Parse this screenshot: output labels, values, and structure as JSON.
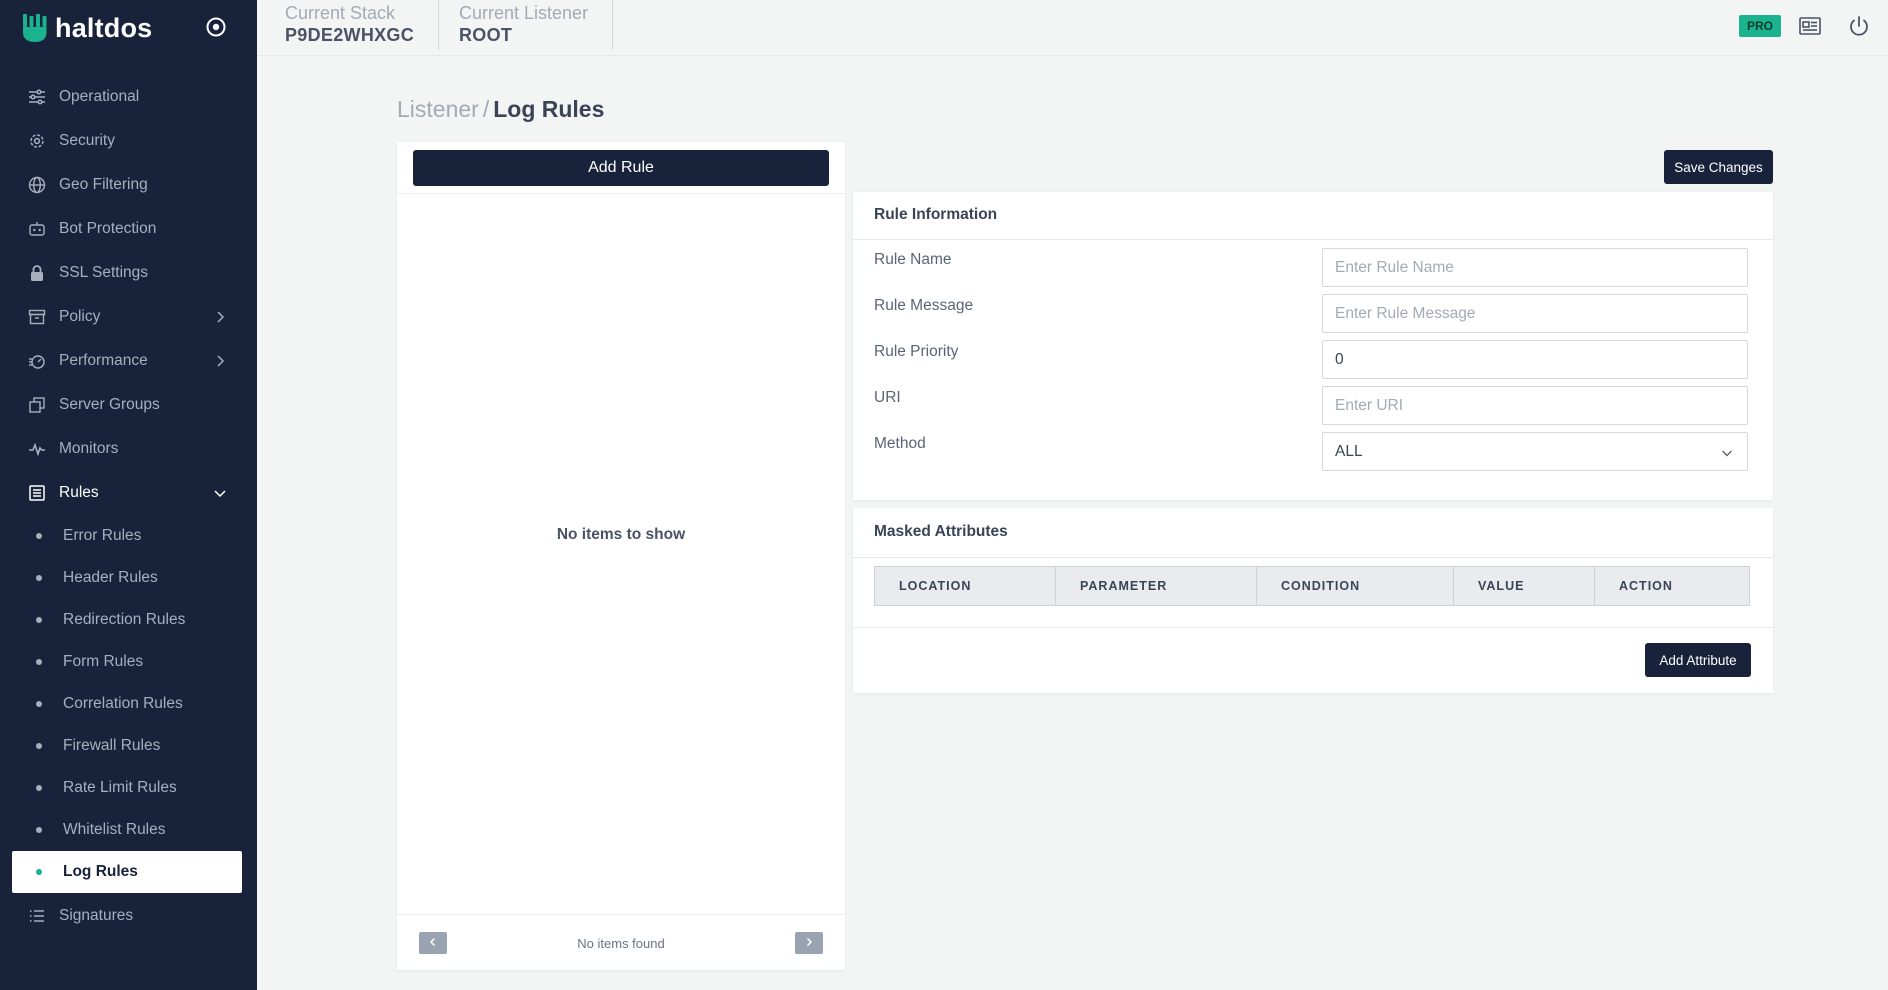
{
  "brand": {
    "name": "haltdos"
  },
  "sidebar": {
    "items": [
      {
        "label": "Operational",
        "icon": "sliders-icon"
      },
      {
        "label": "Security",
        "icon": "gear-icon"
      },
      {
        "label": "Geo Filtering",
        "icon": "globe-icon"
      },
      {
        "label": "Bot Protection",
        "icon": "robot-icon"
      },
      {
        "label": "SSL Settings",
        "icon": "lock-icon"
      },
      {
        "label": "Policy",
        "icon": "archive-icon",
        "has_children": true
      },
      {
        "label": "Performance",
        "icon": "speedometer-icon",
        "has_children": true
      },
      {
        "label": "Server Groups",
        "icon": "copy-icon"
      },
      {
        "label": "Monitors",
        "icon": "pulse-icon"
      },
      {
        "label": "Rules",
        "icon": "list-box-icon",
        "has_children": true,
        "expanded": true
      }
    ],
    "rules_children": [
      {
        "label": "Error Rules"
      },
      {
        "label": "Header Rules"
      },
      {
        "label": "Redirection Rules"
      },
      {
        "label": "Form Rules"
      },
      {
        "label": "Correlation Rules"
      },
      {
        "label": "Firewall Rules"
      },
      {
        "label": "Rate Limit Rules"
      },
      {
        "label": "Whitelist Rules"
      },
      {
        "label": "Log Rules",
        "active": true
      }
    ],
    "signatures": {
      "label": "Signatures",
      "icon": "list-icon"
    }
  },
  "topbar": {
    "stack_label": "Current Stack",
    "stack_value": "P9DE2WHXGC",
    "listener_label": "Current Listener",
    "listener_value": "ROOT",
    "badge": "PRO"
  },
  "breadcrumb": {
    "parent": "Listener",
    "separator": "/",
    "current": "Log Rules"
  },
  "left_panel": {
    "add_rule_label": "Add Rule",
    "empty_text": "No items to show",
    "pager_text": "No items found",
    "prev": "‹",
    "next": "›"
  },
  "save_label": "Save Changes",
  "rule_info": {
    "title": "Rule Information",
    "fields": [
      {
        "label": "Rule Name",
        "placeholder": "Enter Rule Name",
        "value": ""
      },
      {
        "label": "Rule Message",
        "placeholder": "Enter Rule Message",
        "value": ""
      },
      {
        "label": "Rule Priority",
        "placeholder": "",
        "value": "0"
      },
      {
        "label": "URI",
        "placeholder": "Enter URI",
        "value": ""
      }
    ],
    "method": {
      "label": "Method",
      "value": "ALL"
    }
  },
  "masked": {
    "title": "Masked Attributes",
    "columns": [
      "LOCATION",
      "PARAMETER",
      "CONDITION",
      "VALUE",
      "ACTION"
    ],
    "add_label": "Add Attribute"
  },
  "colors": {
    "sidebar_bg": "#18223a",
    "accent": "#1bb38f",
    "page_bg": "#f3f4f4"
  }
}
